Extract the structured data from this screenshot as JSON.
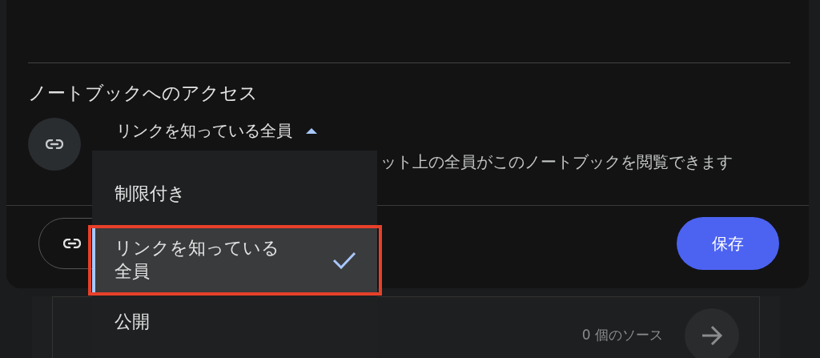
{
  "access": {
    "title": "ノートブックへのアクセス",
    "dropdown": {
      "label": "リンクを知っている全員",
      "expanded": true
    },
    "description": "ット上の全員がこのノートブックを閲覧できます"
  },
  "footer": {
    "save_button": "保存"
  },
  "menu": {
    "items": [
      {
        "label": "制限付き",
        "selected": false
      },
      {
        "label": "リンクを知っている全員",
        "selected": true
      },
      {
        "label": "公開",
        "selected": false
      }
    ]
  },
  "background_card": {
    "source_count": "0 個のソース"
  }
}
